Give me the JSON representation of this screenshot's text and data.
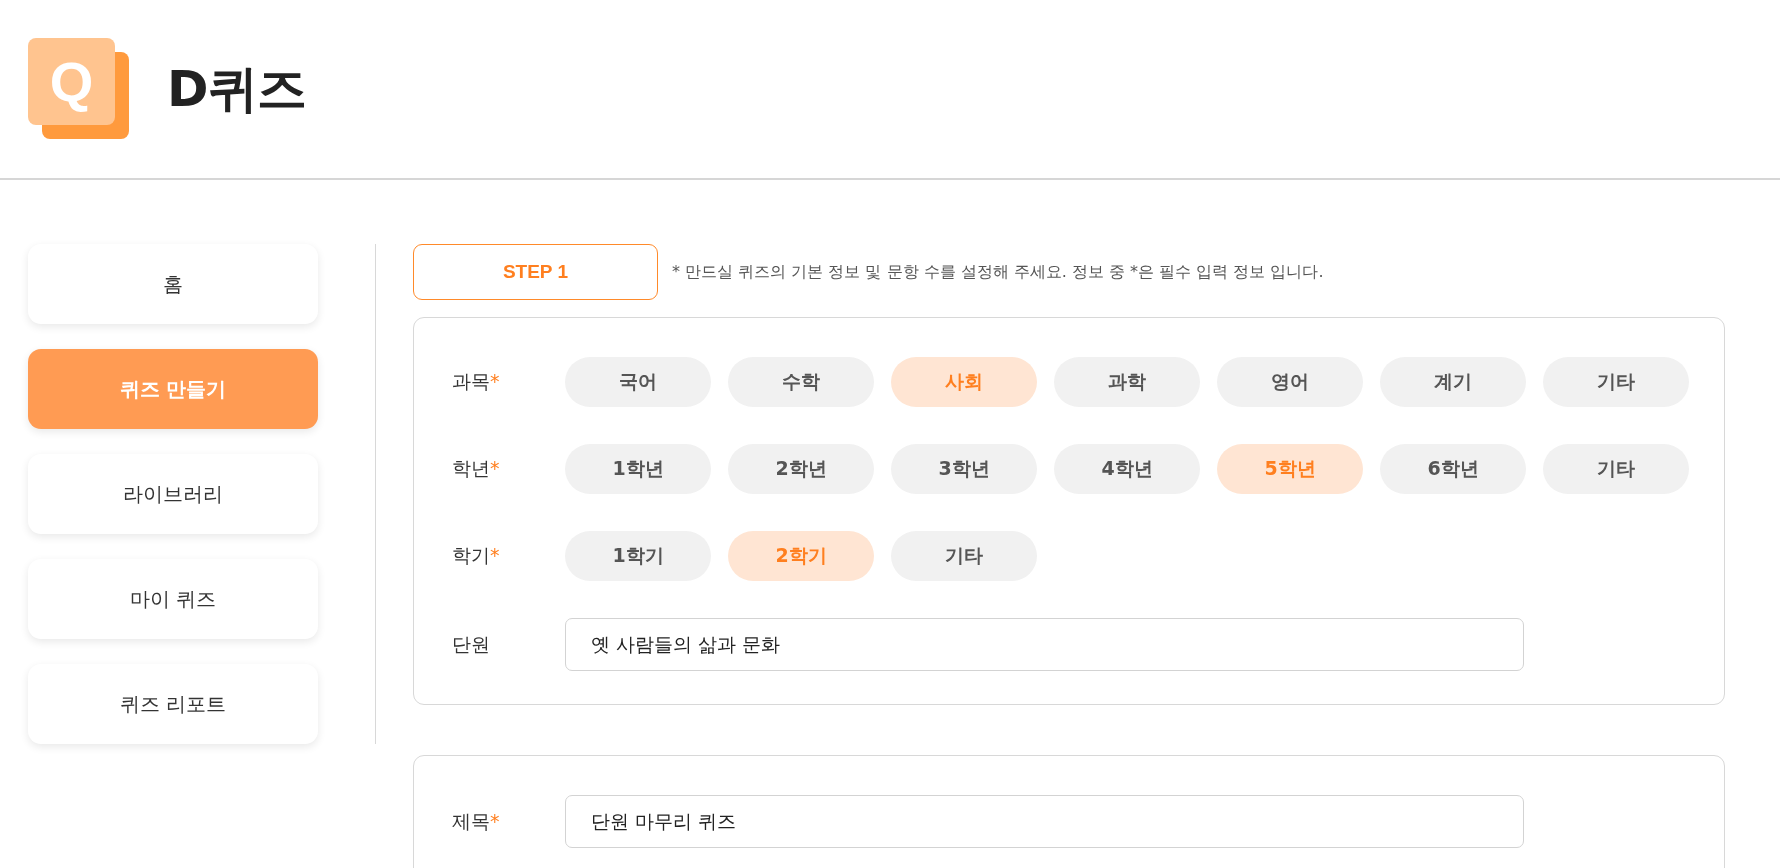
{
  "header": {
    "logo_letter": "Q",
    "title": "D퀴즈"
  },
  "sidebar": {
    "items": [
      {
        "label": "홈",
        "selected": false
      },
      {
        "label": "퀴즈 만들기",
        "selected": true
      },
      {
        "label": "라이브러리",
        "selected": false
      },
      {
        "label": "마이 퀴즈",
        "selected": false
      },
      {
        "label": "퀴즈 리포트",
        "selected": false
      }
    ]
  },
  "step": {
    "label": "STEP 1",
    "note": "* 만드실 퀴즈의 기본 정보 및 문항 수를 설정해 주세요. 정보 중 *은 필수 입력 정보 입니다."
  },
  "cards": [
    {
      "rows": [
        {
          "kind": "choices",
          "label": "과목",
          "required_mark": "*",
          "options": [
            {
              "label": "국어",
              "selected": false
            },
            {
              "label": "수학",
              "selected": false
            },
            {
              "label": "사회",
              "selected": true
            },
            {
              "label": "과학",
              "selected": false
            },
            {
              "label": "영어",
              "selected": false
            },
            {
              "label": "계기",
              "selected": false
            },
            {
              "label": "기타",
              "selected": false
            }
          ]
        },
        {
          "kind": "choices",
          "label": "학년",
          "required_mark": "*",
          "options": [
            {
              "label": "1학년",
              "selected": false
            },
            {
              "label": "2학년",
              "selected": false
            },
            {
              "label": "3학년",
              "selected": false
            },
            {
              "label": "4학년",
              "selected": false
            },
            {
              "label": "5학년",
              "selected": true
            },
            {
              "label": "6학년",
              "selected": false
            },
            {
              "label": "기타",
              "selected": false
            }
          ]
        },
        {
          "kind": "choices",
          "label": "학기",
          "required_mark": "*",
          "options": [
            {
              "label": "1학기",
              "selected": false
            },
            {
              "label": "2학기",
              "selected": true
            },
            {
              "label": "기타",
              "selected": false
            }
          ]
        },
        {
          "kind": "text",
          "label": "단원",
          "value": "옛 사람들의 삶과 문화"
        }
      ]
    },
    {
      "rows": [
        {
          "kind": "text",
          "label": "제목",
          "required_mark": "*",
          "value": "단원 마무리 퀴즈"
        }
      ]
    }
  ]
}
